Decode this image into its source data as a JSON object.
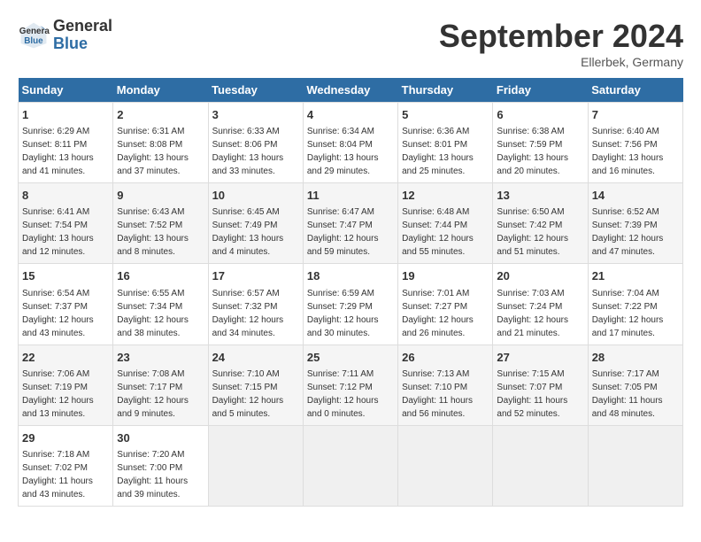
{
  "header": {
    "logo_line1": "General",
    "logo_line2": "Blue",
    "month": "September 2024",
    "location": "Ellerbek, Germany"
  },
  "days_of_week": [
    "Sunday",
    "Monday",
    "Tuesday",
    "Wednesday",
    "Thursday",
    "Friday",
    "Saturday"
  ],
  "weeks": [
    [
      {
        "day": "1",
        "info": "Sunrise: 6:29 AM\nSunset: 8:11 PM\nDaylight: 13 hours and 41 minutes."
      },
      {
        "day": "2",
        "info": "Sunrise: 6:31 AM\nSunset: 8:08 PM\nDaylight: 13 hours and 37 minutes."
      },
      {
        "day": "3",
        "info": "Sunrise: 6:33 AM\nSunset: 8:06 PM\nDaylight: 13 hours and 33 minutes."
      },
      {
        "day": "4",
        "info": "Sunrise: 6:34 AM\nSunset: 8:04 PM\nDaylight: 13 hours and 29 minutes."
      },
      {
        "day": "5",
        "info": "Sunrise: 6:36 AM\nSunset: 8:01 PM\nDaylight: 13 hours and 25 minutes."
      },
      {
        "day": "6",
        "info": "Sunrise: 6:38 AM\nSunset: 7:59 PM\nDaylight: 13 hours and 20 minutes."
      },
      {
        "day": "7",
        "info": "Sunrise: 6:40 AM\nSunset: 7:56 PM\nDaylight: 13 hours and 16 minutes."
      }
    ],
    [
      {
        "day": "8",
        "info": "Sunrise: 6:41 AM\nSunset: 7:54 PM\nDaylight: 13 hours and 12 minutes."
      },
      {
        "day": "9",
        "info": "Sunrise: 6:43 AM\nSunset: 7:52 PM\nDaylight: 13 hours and 8 minutes."
      },
      {
        "day": "10",
        "info": "Sunrise: 6:45 AM\nSunset: 7:49 PM\nDaylight: 13 hours and 4 minutes."
      },
      {
        "day": "11",
        "info": "Sunrise: 6:47 AM\nSunset: 7:47 PM\nDaylight: 12 hours and 59 minutes."
      },
      {
        "day": "12",
        "info": "Sunrise: 6:48 AM\nSunset: 7:44 PM\nDaylight: 12 hours and 55 minutes."
      },
      {
        "day": "13",
        "info": "Sunrise: 6:50 AM\nSunset: 7:42 PM\nDaylight: 12 hours and 51 minutes."
      },
      {
        "day": "14",
        "info": "Sunrise: 6:52 AM\nSunset: 7:39 PM\nDaylight: 12 hours and 47 minutes."
      }
    ],
    [
      {
        "day": "15",
        "info": "Sunrise: 6:54 AM\nSunset: 7:37 PM\nDaylight: 12 hours and 43 minutes."
      },
      {
        "day": "16",
        "info": "Sunrise: 6:55 AM\nSunset: 7:34 PM\nDaylight: 12 hours and 38 minutes."
      },
      {
        "day": "17",
        "info": "Sunrise: 6:57 AM\nSunset: 7:32 PM\nDaylight: 12 hours and 34 minutes."
      },
      {
        "day": "18",
        "info": "Sunrise: 6:59 AM\nSunset: 7:29 PM\nDaylight: 12 hours and 30 minutes."
      },
      {
        "day": "19",
        "info": "Sunrise: 7:01 AM\nSunset: 7:27 PM\nDaylight: 12 hours and 26 minutes."
      },
      {
        "day": "20",
        "info": "Sunrise: 7:03 AM\nSunset: 7:24 PM\nDaylight: 12 hours and 21 minutes."
      },
      {
        "day": "21",
        "info": "Sunrise: 7:04 AM\nSunset: 7:22 PM\nDaylight: 12 hours and 17 minutes."
      }
    ],
    [
      {
        "day": "22",
        "info": "Sunrise: 7:06 AM\nSunset: 7:19 PM\nDaylight: 12 hours and 13 minutes."
      },
      {
        "day": "23",
        "info": "Sunrise: 7:08 AM\nSunset: 7:17 PM\nDaylight: 12 hours and 9 minutes."
      },
      {
        "day": "24",
        "info": "Sunrise: 7:10 AM\nSunset: 7:15 PM\nDaylight: 12 hours and 5 minutes."
      },
      {
        "day": "25",
        "info": "Sunrise: 7:11 AM\nSunset: 7:12 PM\nDaylight: 12 hours and 0 minutes."
      },
      {
        "day": "26",
        "info": "Sunrise: 7:13 AM\nSunset: 7:10 PM\nDaylight: 11 hours and 56 minutes."
      },
      {
        "day": "27",
        "info": "Sunrise: 7:15 AM\nSunset: 7:07 PM\nDaylight: 11 hours and 52 minutes."
      },
      {
        "day": "28",
        "info": "Sunrise: 7:17 AM\nSunset: 7:05 PM\nDaylight: 11 hours and 48 minutes."
      }
    ],
    [
      {
        "day": "29",
        "info": "Sunrise: 7:18 AM\nSunset: 7:02 PM\nDaylight: 11 hours and 43 minutes."
      },
      {
        "day": "30",
        "info": "Sunrise: 7:20 AM\nSunset: 7:00 PM\nDaylight: 11 hours and 39 minutes."
      },
      {
        "day": "",
        "info": ""
      },
      {
        "day": "",
        "info": ""
      },
      {
        "day": "",
        "info": ""
      },
      {
        "day": "",
        "info": ""
      },
      {
        "day": "",
        "info": ""
      }
    ]
  ]
}
